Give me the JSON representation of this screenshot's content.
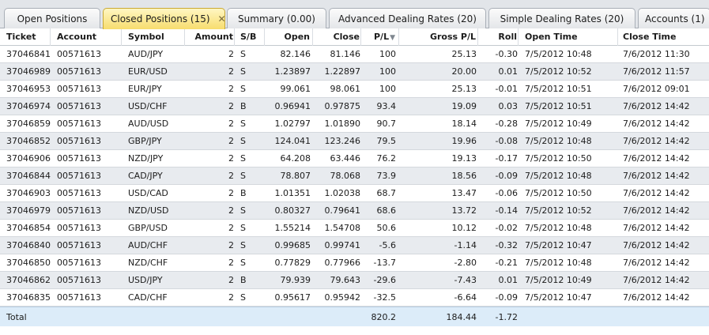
{
  "tabs": [
    {
      "label": "Open Positions"
    },
    {
      "label": "Closed Positions (15)"
    },
    {
      "label": "Summary (0.00)"
    },
    {
      "label": "Advanced Dealing Rates (20)"
    },
    {
      "label": "Simple Dealing Rates (20)"
    },
    {
      "label": "Accounts (1)"
    }
  ],
  "active_tab": "Closed Positions (15)",
  "close_symbol": "✕",
  "columns": {
    "ticket": "Ticket",
    "account": "Account",
    "symbol": "Symbol",
    "amount": "Amount",
    "sb": "S/B",
    "open": "Open",
    "close": "Close",
    "pl": "P/L",
    "gross": "Gross P/L",
    "roll": "Roll",
    "open_time": "Open Time",
    "close_time": "Close Time"
  },
  "sort_icon": "sort-descending-icon",
  "rows": [
    {
      "ticket": "37046841",
      "account": "00571613",
      "symbol": "AUD/JPY",
      "amount": "2",
      "sb": "S",
      "open": "82.146",
      "close": "81.146",
      "pl": "100",
      "gross": "25.13",
      "roll": "-0.30",
      "open_time": "7/5/2012 10:48",
      "close_time": "7/6/2012 11:30"
    },
    {
      "ticket": "37046989",
      "account": "00571613",
      "symbol": "EUR/USD",
      "amount": "2",
      "sb": "S",
      "open": "1.23897",
      "close": "1.22897",
      "pl": "100",
      "gross": "20.00",
      "roll": "0.01",
      "open_time": "7/5/2012 10:52",
      "close_time": "7/6/2012 11:57"
    },
    {
      "ticket": "37046953",
      "account": "00571613",
      "symbol": "EUR/JPY",
      "amount": "2",
      "sb": "S",
      "open": "99.061",
      "close": "98.061",
      "pl": "100",
      "gross": "25.13",
      "roll": "-0.01",
      "open_time": "7/5/2012 10:51",
      "close_time": "7/6/2012 09:01"
    },
    {
      "ticket": "37046974",
      "account": "00571613",
      "symbol": "USD/CHF",
      "amount": "2",
      "sb": "B",
      "open": "0.96941",
      "close": "0.97875",
      "pl": "93.4",
      "gross": "19.09",
      "roll": "0.03",
      "open_time": "7/5/2012 10:51",
      "close_time": "7/6/2012 14:42"
    },
    {
      "ticket": "37046859",
      "account": "00571613",
      "symbol": "AUD/USD",
      "amount": "2",
      "sb": "S",
      "open": "1.02797",
      "close": "1.01890",
      "pl": "90.7",
      "gross": "18.14",
      "roll": "-0.28",
      "open_time": "7/5/2012 10:49",
      "close_time": "7/6/2012 14:42"
    },
    {
      "ticket": "37046852",
      "account": "00571613",
      "symbol": "GBP/JPY",
      "amount": "2",
      "sb": "S",
      "open": "124.041",
      "close": "123.246",
      "pl": "79.5",
      "gross": "19.96",
      "roll": "-0.08",
      "open_time": "7/5/2012 10:48",
      "close_time": "7/6/2012 14:42"
    },
    {
      "ticket": "37046906",
      "account": "00571613",
      "symbol": "NZD/JPY",
      "amount": "2",
      "sb": "S",
      "open": "64.208",
      "close": "63.446",
      "pl": "76.2",
      "gross": "19.13",
      "roll": "-0.17",
      "open_time": "7/5/2012 10:50",
      "close_time": "7/6/2012 14:42"
    },
    {
      "ticket": "37046844",
      "account": "00571613",
      "symbol": "CAD/JPY",
      "amount": "2",
      "sb": "S",
      "open": "78.807",
      "close": "78.068",
      "pl": "73.9",
      "gross": "18.56",
      "roll": "-0.09",
      "open_time": "7/5/2012 10:48",
      "close_time": "7/6/2012 14:42"
    },
    {
      "ticket": "37046903",
      "account": "00571613",
      "symbol": "USD/CAD",
      "amount": "2",
      "sb": "B",
      "open": "1.01351",
      "close": "1.02038",
      "pl": "68.7",
      "gross": "13.47",
      "roll": "-0.06",
      "open_time": "7/5/2012 10:50",
      "close_time": "7/6/2012 14:42"
    },
    {
      "ticket": "37046979",
      "account": "00571613",
      "symbol": "NZD/USD",
      "amount": "2",
      "sb": "S",
      "open": "0.80327",
      "close": "0.79641",
      "pl": "68.6",
      "gross": "13.72",
      "roll": "-0.14",
      "open_time": "7/5/2012 10:52",
      "close_time": "7/6/2012 14:42"
    },
    {
      "ticket": "37046854",
      "account": "00571613",
      "symbol": "GBP/USD",
      "amount": "2",
      "sb": "S",
      "open": "1.55214",
      "close": "1.54708",
      "pl": "50.6",
      "gross": "10.12",
      "roll": "-0.02",
      "open_time": "7/5/2012 10:48",
      "close_time": "7/6/2012 14:42"
    },
    {
      "ticket": "37046840",
      "account": "00571613",
      "symbol": "AUD/CHF",
      "amount": "2",
      "sb": "S",
      "open": "0.99685",
      "close": "0.99741",
      "pl": "-5.6",
      "gross": "-1.14",
      "roll": "-0.32",
      "open_time": "7/5/2012 10:47",
      "close_time": "7/6/2012 14:42"
    },
    {
      "ticket": "37046850",
      "account": "00571613",
      "symbol": "NZD/CHF",
      "amount": "2",
      "sb": "S",
      "open": "0.77829",
      "close": "0.77966",
      "pl": "-13.7",
      "gross": "-2.80",
      "roll": "-0.21",
      "open_time": "7/5/2012 10:48",
      "close_time": "7/6/2012 14:42"
    },
    {
      "ticket": "37046862",
      "account": "00571613",
      "symbol": "USD/JPY",
      "amount": "2",
      "sb": "B",
      "open": "79.939",
      "close": "79.643",
      "pl": "-29.6",
      "gross": "-7.43",
      "roll": "0.01",
      "open_time": "7/5/2012 10:49",
      "close_time": "7/6/2012 14:42"
    },
    {
      "ticket": "37046835",
      "account": "00571613",
      "symbol": "CAD/CHF",
      "amount": "2",
      "sb": "S",
      "open": "0.95617",
      "close": "0.95942",
      "pl": "-32.5",
      "gross": "-6.64",
      "roll": "-0.09",
      "open_time": "7/5/2012 10:47",
      "close_time": "7/6/2012 14:42"
    }
  ],
  "total": {
    "label": "Total",
    "pl": "820.2",
    "gross": "184.44",
    "roll": "-1.72"
  }
}
